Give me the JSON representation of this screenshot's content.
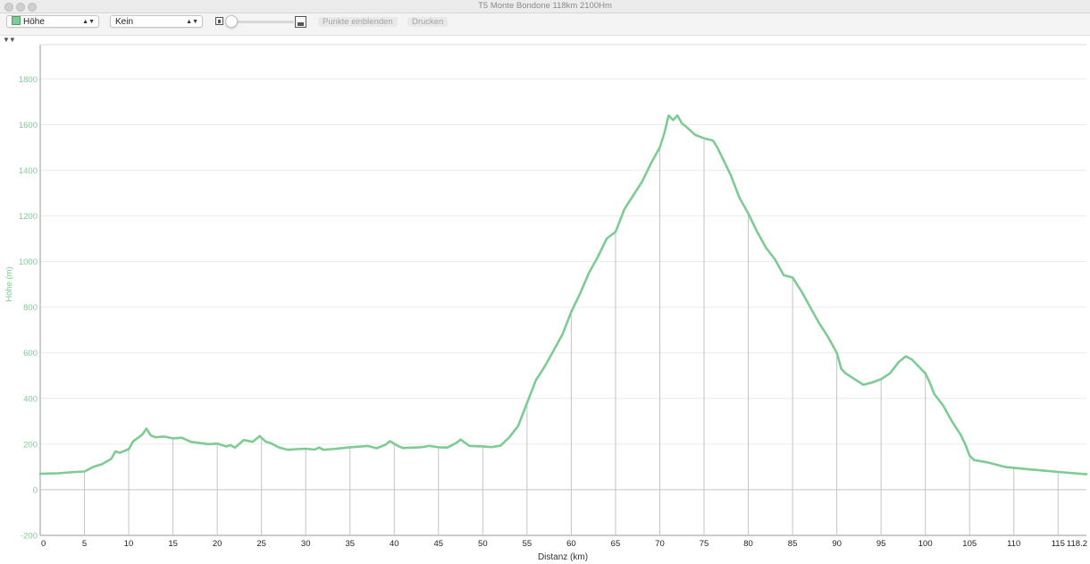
{
  "window": {
    "title": "T5 Monte Bondone 118km 2100Hm"
  },
  "toolbar": {
    "metric_select": "Höhe",
    "overlay_select": "Kein",
    "show_points_label": "Punkte einblenden",
    "print_label": "Drucken"
  },
  "markers": "▼▼",
  "colors": {
    "line": "#7ecb94",
    "axis_label": "#7ecb94",
    "grid_v": "#c4c4c4",
    "grid_h": "#ececec",
    "zero_line": "#c4c4c4"
  },
  "chart_data": {
    "type": "line",
    "xlabel": "Distanz (km)",
    "ylabel": "Höhe (m)",
    "xlim": [
      0,
      118.2
    ],
    "ylim": [
      -200,
      1950
    ],
    "x_ticks": [
      "0",
      "5",
      "10",
      "15",
      "20",
      "25",
      "30",
      "35",
      "40",
      "45",
      "50",
      "55",
      "60",
      "65",
      "70",
      "75",
      "80",
      "85",
      "90",
      "95",
      "100",
      "105",
      "110",
      "115",
      "118.2"
    ],
    "y_ticks": [
      "-200",
      "0",
      "200",
      "400",
      "600",
      "800",
      "1000",
      "1200",
      "1400",
      "1600",
      "1800"
    ],
    "grid": true,
    "series": [
      {
        "values": [
          [
            0,
            70
          ],
          [
            2,
            72
          ],
          [
            4,
            78
          ],
          [
            5,
            80
          ],
          [
            6,
            100
          ],
          [
            7,
            112
          ],
          [
            8,
            135
          ],
          [
            8.5,
            168
          ],
          [
            9,
            162
          ],
          [
            10,
            178
          ],
          [
            10.5,
            212
          ],
          [
            11.5,
            240
          ],
          [
            12,
            268
          ],
          [
            12.5,
            238
          ],
          [
            13,
            230
          ],
          [
            14,
            233
          ],
          [
            15,
            225
          ],
          [
            16,
            228
          ],
          [
            17,
            210
          ],
          [
            18,
            205
          ],
          [
            19,
            200
          ],
          [
            20,
            202
          ],
          [
            21,
            190
          ],
          [
            21.5,
            195
          ],
          [
            22,
            185
          ],
          [
            23,
            218
          ],
          [
            24,
            210
          ],
          [
            24.8,
            235
          ],
          [
            25.5,
            210
          ],
          [
            26,
            205
          ],
          [
            27,
            185
          ],
          [
            28,
            175
          ],
          [
            29,
            178
          ],
          [
            30,
            180
          ],
          [
            31,
            176
          ],
          [
            31.5,
            185
          ],
          [
            32,
            175
          ],
          [
            33,
            178
          ],
          [
            35,
            186
          ],
          [
            37,
            192
          ],
          [
            38,
            182
          ],
          [
            39,
            197
          ],
          [
            39.5,
            213
          ],
          [
            40.5,
            190
          ],
          [
            41,
            183
          ],
          [
            43,
            186
          ],
          [
            44,
            192
          ],
          [
            45,
            186
          ],
          [
            46,
            185
          ],
          [
            47,
            205
          ],
          [
            47.5,
            220
          ],
          [
            48.5,
            192
          ],
          [
            50,
            190
          ],
          [
            51,
            187
          ],
          [
            52,
            193
          ],
          [
            53,
            230
          ],
          [
            54,
            280
          ],
          [
            55,
            380
          ],
          [
            56,
            480
          ],
          [
            57,
            540
          ],
          [
            58,
            610
          ],
          [
            59,
            680
          ],
          [
            60,
            780
          ],
          [
            61,
            860
          ],
          [
            62,
            950
          ],
          [
            63,
            1020
          ],
          [
            64,
            1100
          ],
          [
            65,
            1130
          ],
          [
            66,
            1230
          ],
          [
            67,
            1290
          ],
          [
            68,
            1350
          ],
          [
            69,
            1430
          ],
          [
            70,
            1500
          ],
          [
            70.5,
            1560
          ],
          [
            71,
            1640
          ],
          [
            71.5,
            1620
          ],
          [
            72,
            1640
          ],
          [
            72.5,
            1605
          ],
          [
            73,
            1590
          ],
          [
            74,
            1555
          ],
          [
            75,
            1540
          ],
          [
            76,
            1530
          ],
          [
            76.5,
            1500
          ],
          [
            77,
            1460
          ],
          [
            78,
            1380
          ],
          [
            79,
            1280
          ],
          [
            80,
            1210
          ],
          [
            81,
            1130
          ],
          [
            82,
            1060
          ],
          [
            83,
            1010
          ],
          [
            84,
            940
          ],
          [
            85,
            930
          ],
          [
            86,
            870
          ],
          [
            87,
            800
          ],
          [
            88,
            730
          ],
          [
            89,
            670
          ],
          [
            90,
            600
          ],
          [
            90.5,
            530
          ],
          [
            91,
            510
          ],
          [
            92,
            485
          ],
          [
            93,
            460
          ],
          [
            94,
            470
          ],
          [
            95,
            485
          ],
          [
            96,
            510
          ],
          [
            97,
            560
          ],
          [
            97.8,
            585
          ],
          [
            98.5,
            570
          ],
          [
            99,
            550
          ],
          [
            100,
            510
          ],
          [
            100.5,
            470
          ],
          [
            101,
            420
          ],
          [
            102,
            370
          ],
          [
            103,
            300
          ],
          [
            104,
            240
          ],
          [
            104.5,
            200
          ],
          [
            105,
            150
          ],
          [
            105.5,
            130
          ],
          [
            107,
            120
          ],
          [
            109,
            100
          ],
          [
            111,
            92
          ],
          [
            113,
            85
          ],
          [
            115,
            78
          ],
          [
            118.2,
            68
          ]
        ]
      }
    ]
  }
}
